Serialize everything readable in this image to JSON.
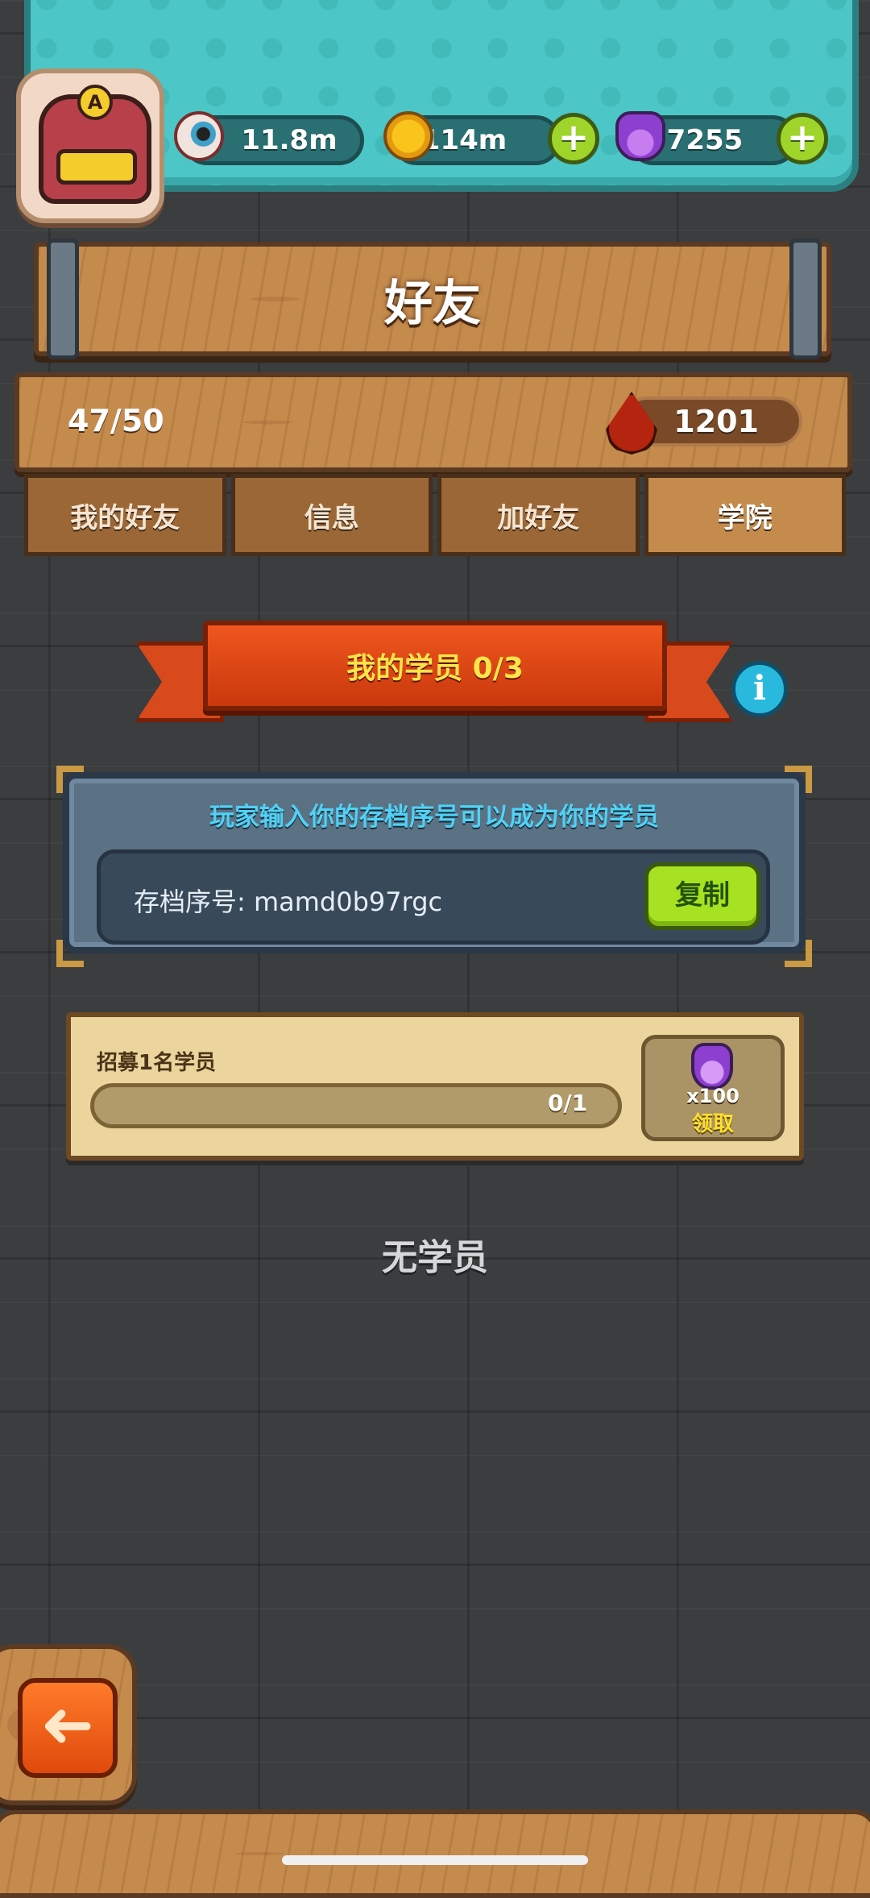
{
  "resources": {
    "eyes": "11.8m",
    "coins": "114m",
    "potions": "7255",
    "coin_add_icon": "plus-icon",
    "potion_add_icon": "plus-icon"
  },
  "avatar": {
    "badge_letter": "A"
  },
  "header": {
    "title": "好友"
  },
  "stats": {
    "friend_count": "47/50",
    "blood": "1201"
  },
  "tabs": [
    {
      "label": "我的好友",
      "active": false
    },
    {
      "label": "信息",
      "active": false
    },
    {
      "label": "加好友",
      "active": false
    },
    {
      "label": "学院",
      "active": true
    }
  ],
  "academy": {
    "banner": "我的学员 0/3",
    "info_icon": "i",
    "instruction": "玩家输入你的存档序号可以成为你的学员",
    "save_code_label": "存档序号: mamd0b97rgc",
    "copy_button": "复制"
  },
  "mission": {
    "label": "招募1名学员",
    "progress_text": "0/1",
    "progress": 0,
    "reward_count": "x100",
    "claim_label": "领取"
  },
  "empty_state": "无学员",
  "back_button": {
    "icon": "arrow-left-icon",
    "glyph": "➜"
  },
  "colors": {
    "accent_teal": "#4cc6c6",
    "ribbon_red": "#e24a16",
    "copy_green": "#a6e221",
    "banner_text": "#ffe44a",
    "instruction_text": "#4fd2f5"
  }
}
